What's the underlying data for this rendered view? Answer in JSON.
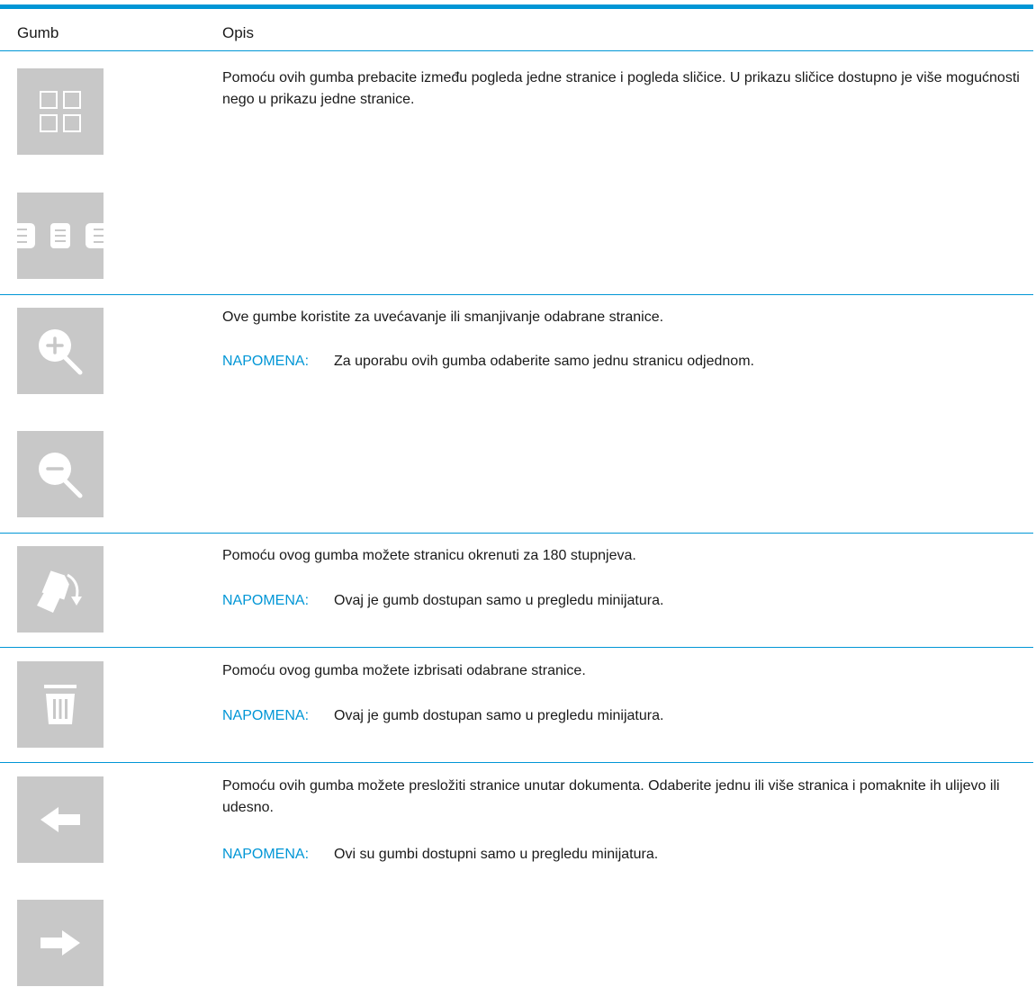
{
  "table": {
    "header": {
      "col_button": "Gumb",
      "col_description": "Opis"
    },
    "rows": [
      {
        "buttons": [
          {
            "icon": "thumbnail-view-icon",
            "label": "thumbnail view"
          },
          {
            "icon": "single-page-view-icon",
            "label": "single page view"
          }
        ],
        "description": "Pomoću ovih gumba prebacite između pogleda jedne stranice i pogleda sličice. U prikazu sličice dostupno je više mogućnosti nego u prikazu jedne stranice."
      },
      {
        "buttons": [
          {
            "icon": "zoom-in-icon"
          },
          {
            "icon": "zoom-out-icon"
          }
        ],
        "description": "Ove gumbe koristite za uvećavanje ili smanjivanje odabrane stranice.",
        "note_label": "NAPOMENA:",
        "note_text": "Za uporabu ovih gumba odaberite samo jednu stranicu odjednom."
      },
      {
        "buttons": [
          {
            "icon": "rotate-page-icon"
          }
        ],
        "description": "Pomoću ovog gumba možete stranicu okrenuti za 180 stupnjeva.",
        "note_label": "NAPOMENA:",
        "note_text": "Ovaj je gumb dostupan samo u pregledu minijatura."
      },
      {
        "buttons": [
          {
            "icon": "trash-icon"
          }
        ],
        "description": "Pomoću ovog gumba možete izbrisati odabrane stranice.",
        "note_label": "NAPOMENA:",
        "note_text": "Ovaj je gumb dostupan samo u pregledu minijatura."
      },
      {
        "buttons": [
          {
            "icon": "arrow-left-icon"
          },
          {
            "icon": "arrow-right-icon"
          }
        ],
        "description": "Pomoću ovih gumba možete presložiti stranice unutar dokumenta. Odaberite jednu ili više stranica i pomaknite ih ulijevo ili udesno.",
        "note_label": "NAPOMENA:",
        "note_text": "Ovi su gumbi dostupni samo u pregledu minijatura."
      }
    ]
  },
  "colors": {
    "accent": "#0096d6",
    "tile_bg": "#c8c8c8",
    "icon": "#ffffff"
  }
}
